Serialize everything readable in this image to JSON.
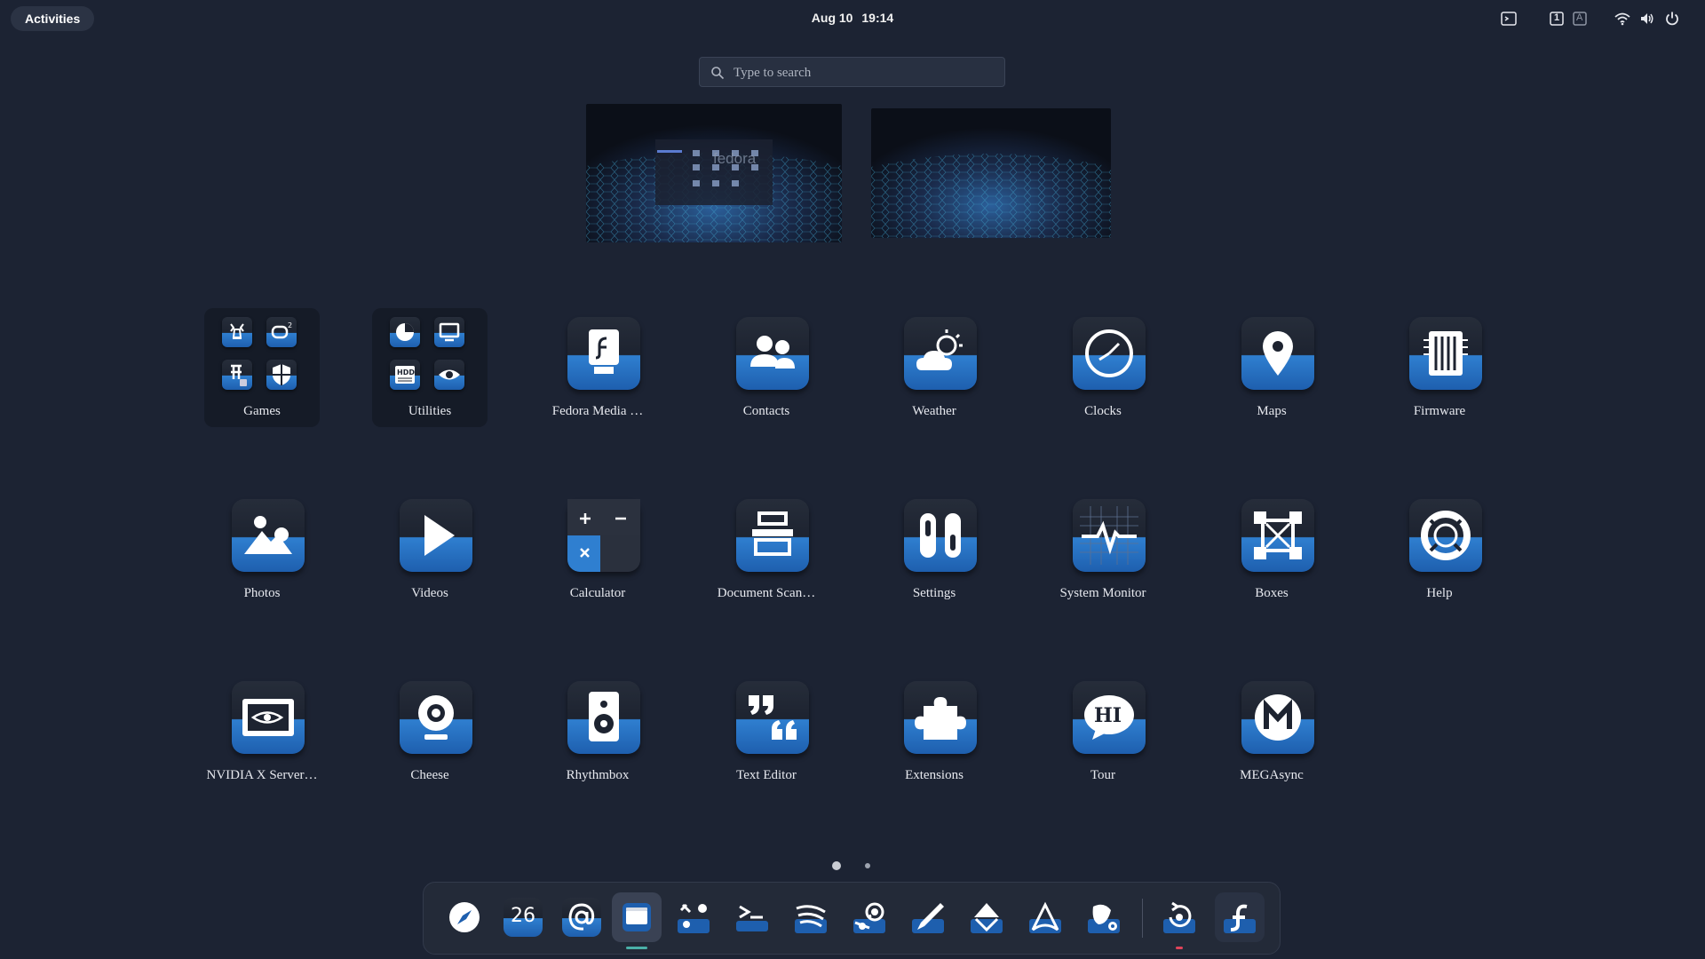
{
  "topbar": {
    "activities_label": "Activities",
    "date": "Aug 10",
    "time": "19:14",
    "tray_icons": [
      "terminal-indicator-icon",
      "workspace-1-icon",
      "keyboard-layout-icon",
      "wifi-icon",
      "volume-icon",
      "power-icon"
    ],
    "workspace_number": "1",
    "keyboard_layout": "A"
  },
  "search": {
    "placeholder": "Type to search"
  },
  "workspace_preview": {
    "watermark": "fedora"
  },
  "app_grid": {
    "folders": [
      {
        "label": "Games",
        "mini_icons": [
          "chess-icon",
          "o2-game-icon",
          "pinball-icon",
          "shield-game-icon"
        ]
      },
      {
        "label": "Utilities",
        "mini_icons": [
          "disk-usage-icon",
          "remote-desktop-icon",
          "disks-icon",
          "viewer-icon"
        ]
      }
    ],
    "apps": [
      {
        "label": "Fedora Media …",
        "icon": "fedora-media-writer-icon"
      },
      {
        "label": "Contacts",
        "icon": "contacts-icon"
      },
      {
        "label": "Weather",
        "icon": "weather-icon"
      },
      {
        "label": "Clocks",
        "icon": "clocks-icon"
      },
      {
        "label": "Maps",
        "icon": "maps-icon"
      },
      {
        "label": "Firmware",
        "icon": "firmware-icon"
      },
      {
        "label": "Photos",
        "icon": "photos-icon"
      },
      {
        "label": "Videos",
        "icon": "videos-icon"
      },
      {
        "label": "Calculator",
        "icon": "calculator-icon"
      },
      {
        "label": "Document Scan…",
        "icon": "document-scanner-icon"
      },
      {
        "label": "Settings",
        "icon": "settings-icon"
      },
      {
        "label": "System Monitor",
        "icon": "system-monitor-icon"
      },
      {
        "label": "Boxes",
        "icon": "boxes-icon"
      },
      {
        "label": "Help",
        "icon": "help-icon"
      },
      {
        "label": "NVIDIA X Server…",
        "icon": "nvidia-settings-icon"
      },
      {
        "label": "Cheese",
        "icon": "cheese-icon"
      },
      {
        "label": "Rhythmbox",
        "icon": "rhythmbox-icon"
      },
      {
        "label": "Text Editor",
        "icon": "text-editor-icon"
      },
      {
        "label": "Extensions",
        "icon": "extensions-icon"
      },
      {
        "label": "Tour",
        "icon": "tour-icon"
      },
      {
        "label": "MEGAsync",
        "icon": "megasync-icon"
      }
    ],
    "pages": 2,
    "current_page": 1
  },
  "dock": {
    "items": [
      {
        "name": "web-browser-icon",
        "running": false
      },
      {
        "name": "calendar-icon",
        "label": "26",
        "running": false
      },
      {
        "name": "mail-icon",
        "running": false
      },
      {
        "name": "files-icon",
        "running": true
      },
      {
        "name": "tweaks-icon",
        "running": false
      },
      {
        "name": "terminal-icon",
        "running": false
      },
      {
        "name": "spotify-icon",
        "running": false
      },
      {
        "name": "steam-icon",
        "running": false
      },
      {
        "name": "inkscape-icon",
        "running": false
      },
      {
        "name": "gitkraken-icon",
        "running": false
      },
      {
        "name": "arduino-icon",
        "running": false
      },
      {
        "name": "gimp-icon",
        "running": false
      },
      {
        "name": "update-manager-icon",
        "running": true
      },
      {
        "name": "fedora-show-apps-icon",
        "running": false
      }
    ],
    "accent_colors": {
      "running": "#4ab0a8",
      "alert": "#e0445a"
    }
  }
}
